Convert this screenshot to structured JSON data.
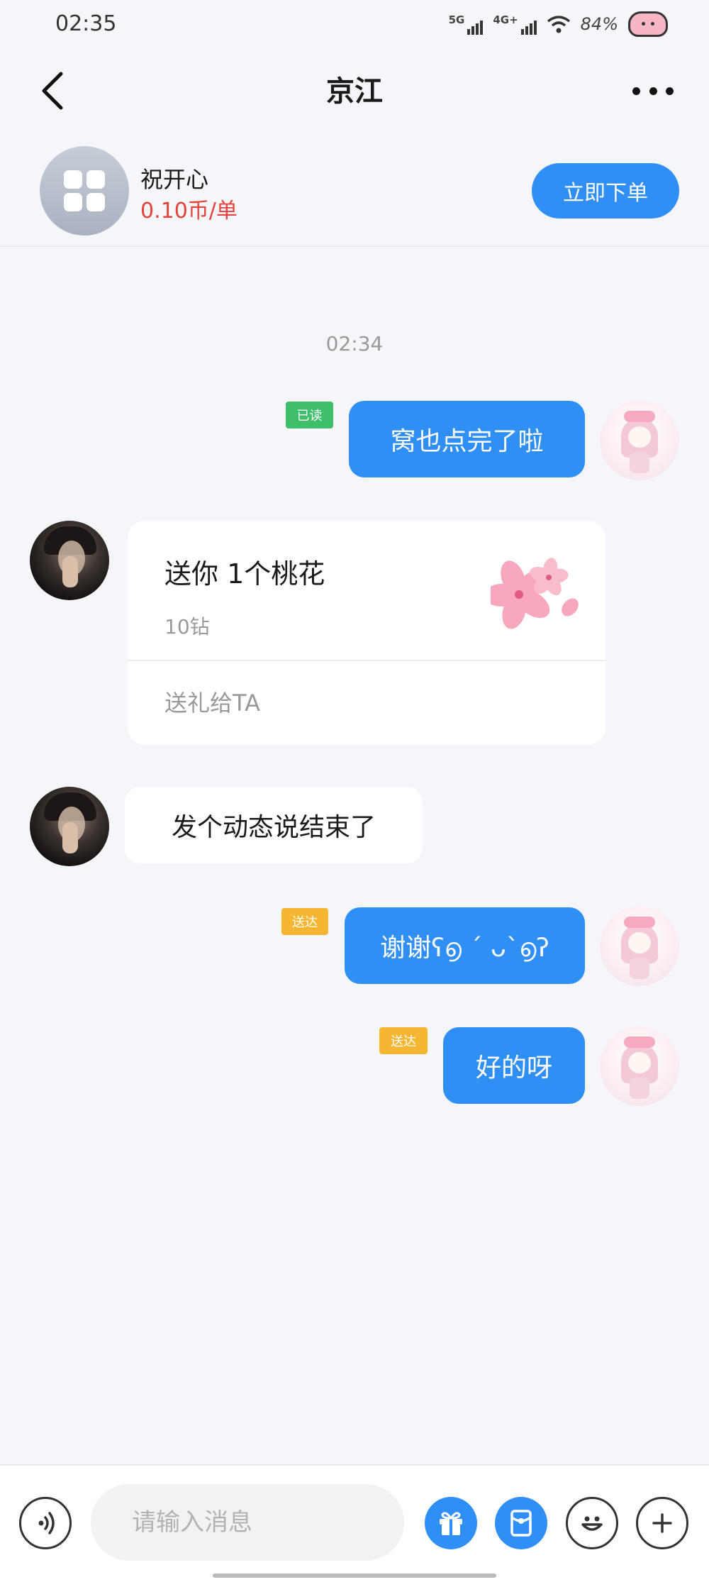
{
  "status_bar": {
    "time": "02:35",
    "net1": "5G",
    "net2": "4G+",
    "battery": "84%"
  },
  "nav": {
    "title": "京江"
  },
  "service": {
    "name": "祝开心",
    "price": "0.10币/单",
    "order_button": "立即下单"
  },
  "chat": {
    "timestamp": "02:34",
    "messages": [
      {
        "sender": "me",
        "text": "窝也点完了啦",
        "status": "已读"
      },
      {
        "sender": "other",
        "type": "gift",
        "title": "送你 1个桃花",
        "price": "10钻",
        "link": "送礼给TA"
      },
      {
        "sender": "other",
        "text": "发个动态说结束了"
      },
      {
        "sender": "me",
        "text": "谢谢ʕ൭ ´ ᴗ`൭ʔ",
        "status": "送达"
      },
      {
        "sender": "me",
        "text": "好的呀",
        "status": "送达"
      }
    ]
  },
  "input": {
    "placeholder": "请输入消息"
  },
  "colors": {
    "accent": "#2f8ff5",
    "price": "#e8403b",
    "read_tag": "#3fbf6a",
    "sent_tag": "#f5b731"
  },
  "icons": [
    "back-icon",
    "more-icon",
    "voice-icon",
    "gift-icon",
    "red-packet-icon",
    "emoji-icon",
    "plus-icon"
  ]
}
